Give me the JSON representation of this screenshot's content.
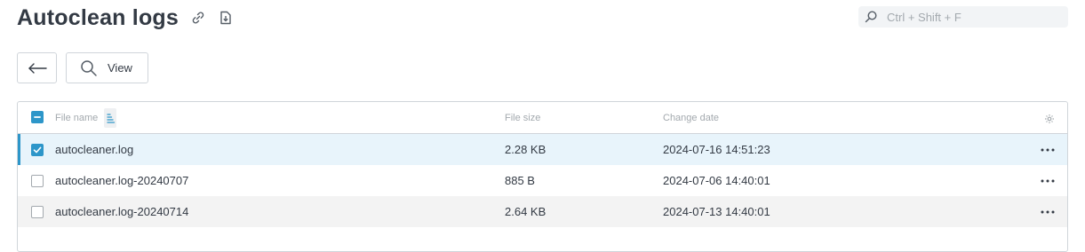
{
  "header": {
    "title": "Autoclean logs",
    "icons": [
      "link-icon",
      "download-icon"
    ]
  },
  "search": {
    "placeholder": "Ctrl + Shift + F",
    "value": ""
  },
  "toolbar": {
    "back_icon": "arrow-left-icon",
    "view_label": "View",
    "view_icon": "magnifier-icon"
  },
  "table": {
    "columns": [
      "File name",
      "File size",
      "Change date"
    ],
    "sort_icon": "sort-ascending-icon",
    "settings_icon": "gear-icon",
    "rows": [
      {
        "name": "autocleaner.log",
        "size": "2.28 KB",
        "date": "2024-07-16 14:51:23",
        "checked": true
      },
      {
        "name": "autocleaner.log-20240707",
        "size": "885 B",
        "date": "2024-07-06 14:40:01",
        "checked": false
      },
      {
        "name": "autocleaner.log-20240714",
        "size": "2.64 KB",
        "date": "2024-07-13 14:40:01",
        "checked": false
      }
    ]
  },
  "colors": {
    "accent": "#2d96c9",
    "selected_row": "#e8f4fb",
    "alt_row": "#f3f3f3",
    "text": "#333a44",
    "muted": "#a3a9ae"
  }
}
